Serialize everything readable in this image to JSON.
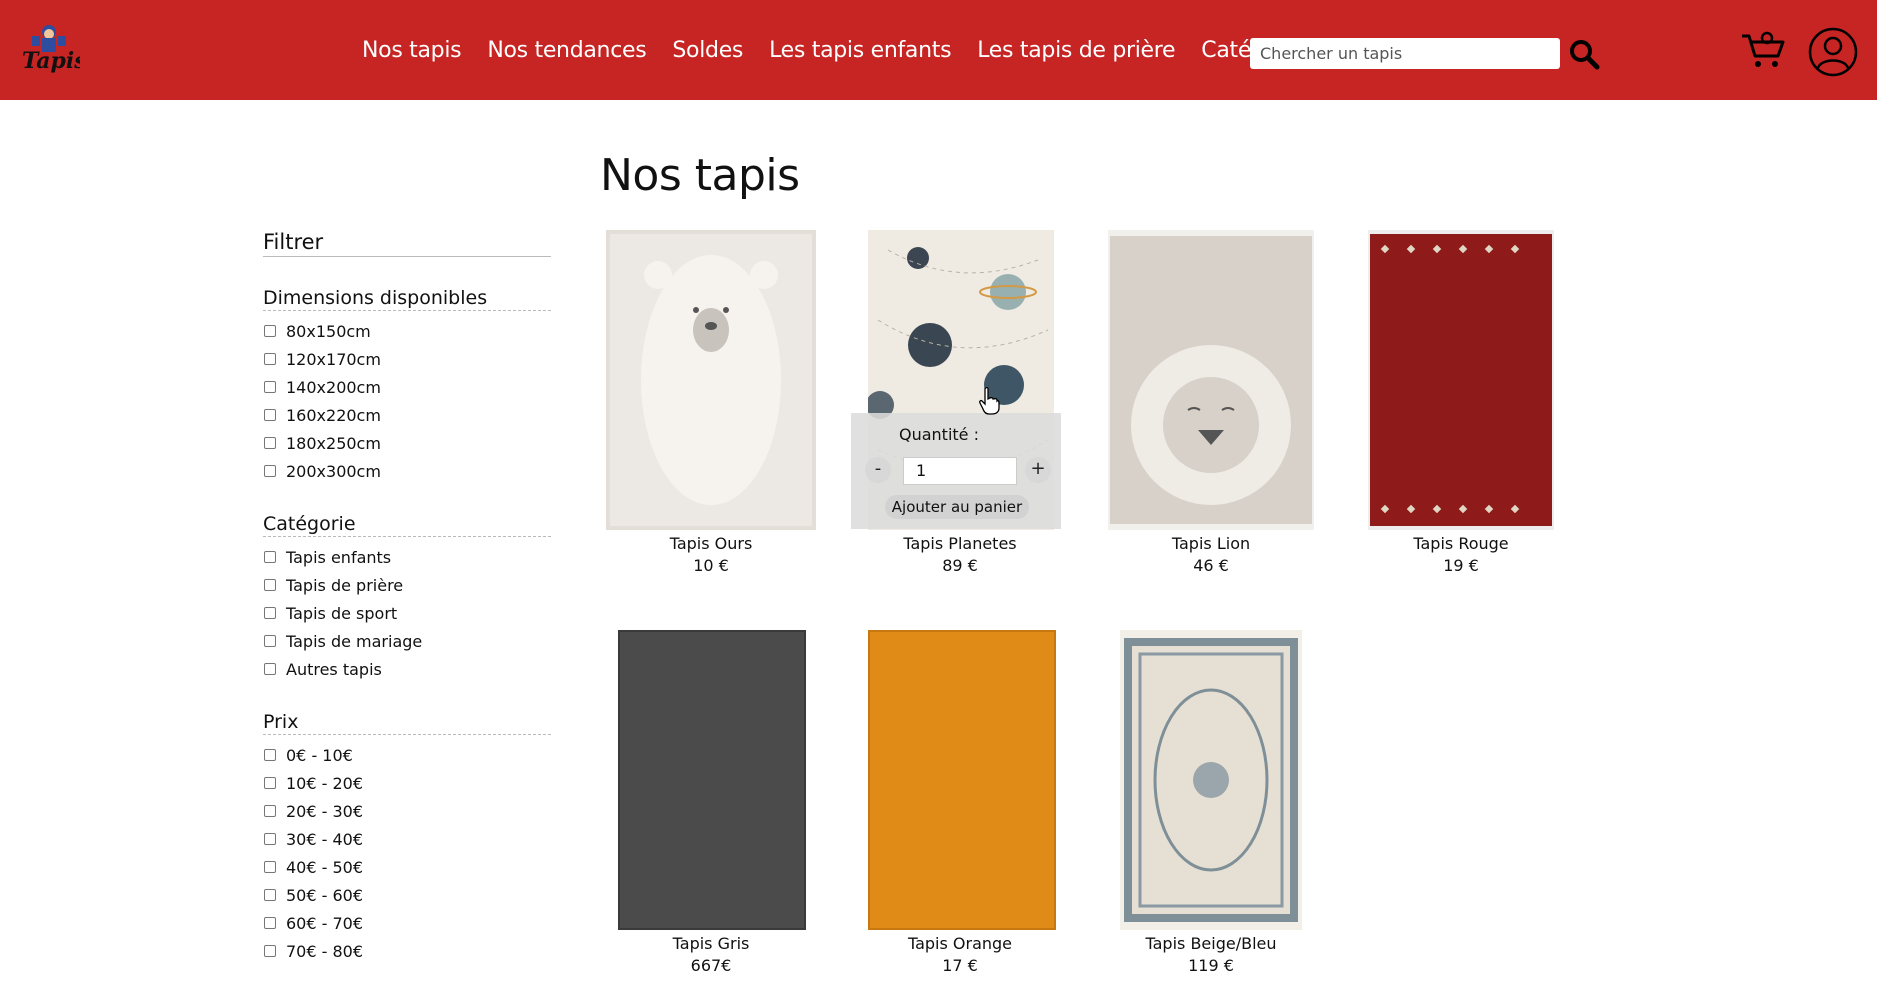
{
  "header": {
    "logo_text": "Tapis",
    "nav": [
      "Nos tapis",
      "Nos tendances",
      "Soldes",
      "Les tapis enfants",
      "Les tapis de prière",
      "Catégorie"
    ],
    "search_placeholder": "Chercher un tapis",
    "icons": {
      "search": "search-icon",
      "cart": "cart-icon",
      "user": "user-icon"
    },
    "brand_color": "#c62524"
  },
  "page_title": "Nos tapis",
  "sidebar": {
    "title": "Filtrer",
    "groups": [
      {
        "title": "Dimensions disponibles",
        "options": [
          "80x150cm",
          "120x170cm",
          "140x200cm",
          "160x220cm",
          "180x250cm",
          "200x300cm"
        ]
      },
      {
        "title": "Catégorie",
        "options": [
          "Tapis enfants",
          "Tapis de prière",
          "Tapis de sport",
          "Tapis de mariage",
          "Autres tapis"
        ]
      },
      {
        "title": "Prix",
        "options": [
          "0€ - 10€",
          "10€ - 20€",
          "20€ - 30€",
          "30€ - 40€",
          "40€ - 50€",
          "50€ - 60€",
          "60€ - 70€",
          "70€ - 80€"
        ]
      }
    ]
  },
  "products": [
    {
      "name": "Tapis Ours",
      "price": "10 €",
      "color": "#ece8e4"
    },
    {
      "name": "Tapis Planetes",
      "price": "89 €",
      "color": "#efebe3"
    },
    {
      "name": "Tapis Lion",
      "price": "46 €",
      "color": "#d7d1ca"
    },
    {
      "name": "Tapis Rouge",
      "price": "19 €",
      "color": "#8e1a1a"
    },
    {
      "name": "Tapis Gris",
      "price": "667€",
      "color": "#4b4b4b"
    },
    {
      "name": "Tapis Orange",
      "price": "17 €",
      "color": "#e08a18"
    },
    {
      "name": "Tapis Beige/Bleu",
      "price": "119 €",
      "color": "#e6e0d4"
    }
  ],
  "quick_add": {
    "label": "Quantité :",
    "quantity": "1",
    "minus": "-",
    "plus": "+",
    "button": "Ajouter au panier"
  }
}
